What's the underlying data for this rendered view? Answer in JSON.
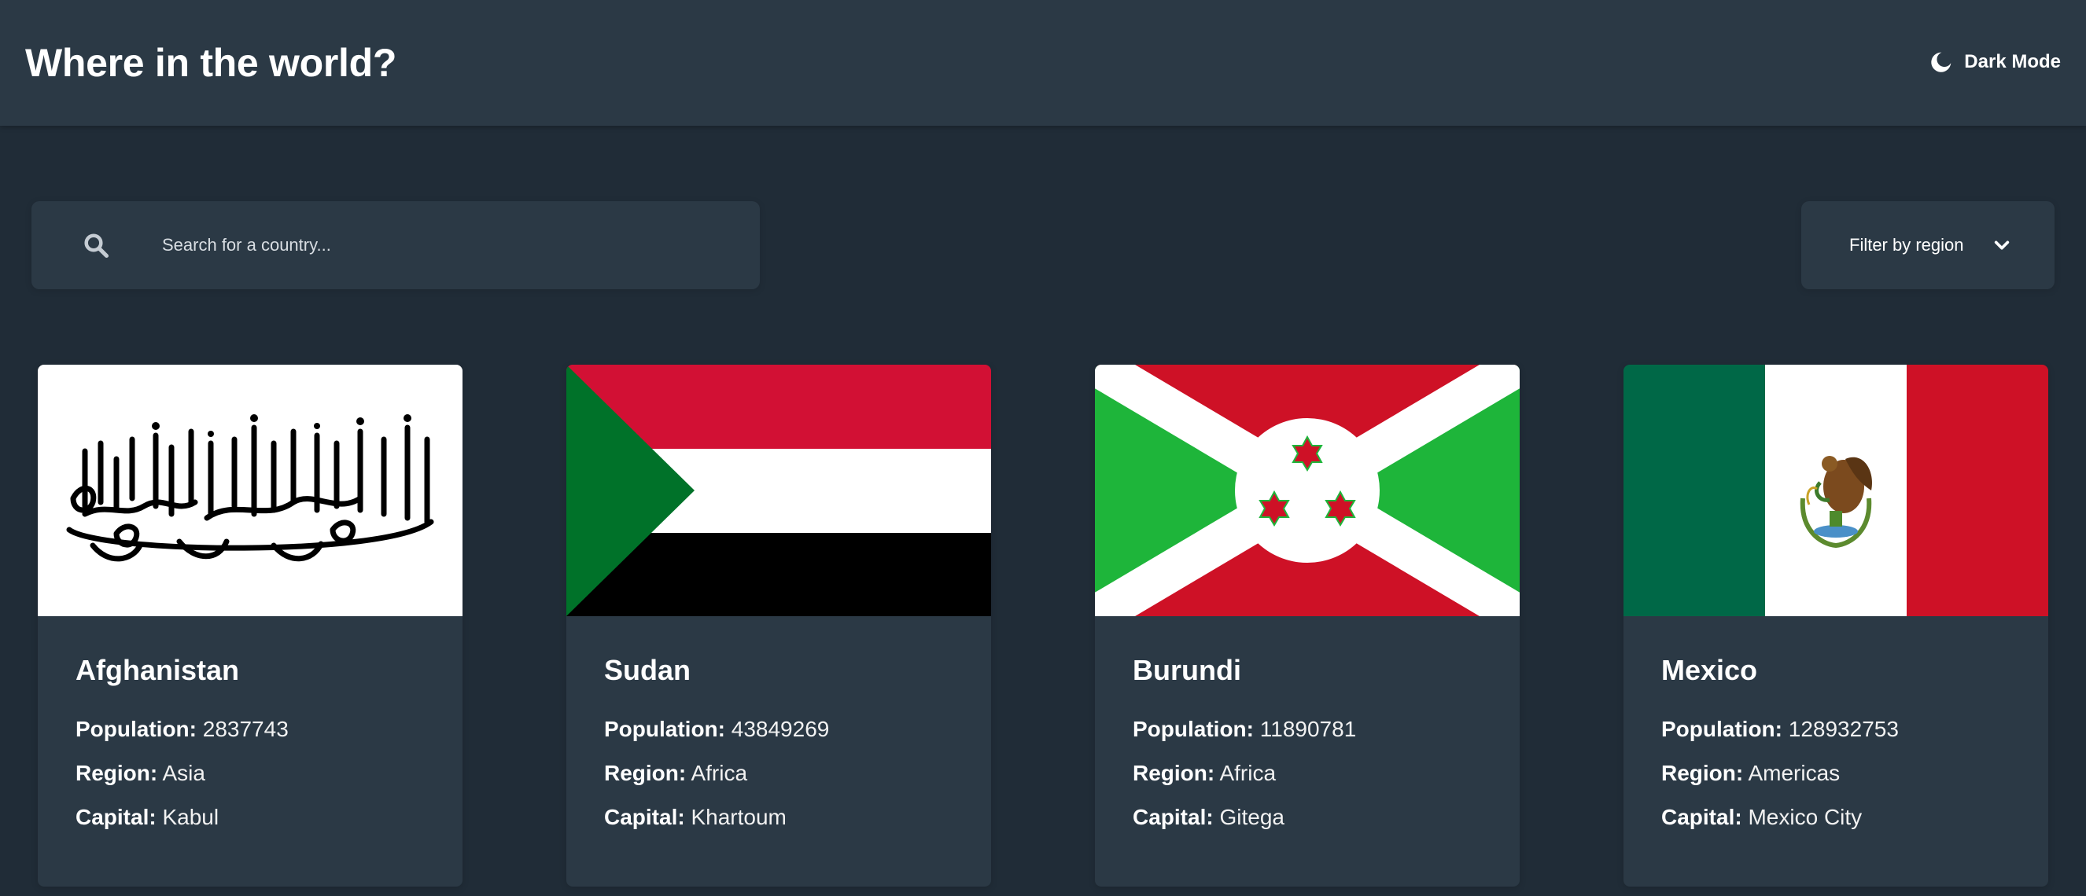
{
  "header": {
    "title": "Where in the world?",
    "theme_toggle_label": "Dark Mode"
  },
  "search": {
    "placeholder": "Search for a country..."
  },
  "filter": {
    "label": "Filter by region"
  },
  "labels": {
    "population": "Population:",
    "region": "Region:",
    "capital": "Capital:"
  },
  "icons": {
    "theme": "moon-icon",
    "search": "search-icon",
    "filter": "chevron-down-icon"
  },
  "colors": {
    "background": "#202c37",
    "elements": "#2b3945",
    "text": "#ffffff"
  },
  "countries": [
    {
      "name": "Afghanistan",
      "population": "2837743",
      "region": "Asia",
      "capital": "Kabul",
      "flag": "afghanistan-flag"
    },
    {
      "name": "Sudan",
      "population": "43849269",
      "region": "Africa",
      "capital": "Khartoum",
      "flag": "sudan-flag"
    },
    {
      "name": "Burundi",
      "population": "11890781",
      "region": "Africa",
      "capital": "Gitega",
      "flag": "burundi-flag"
    },
    {
      "name": "Mexico",
      "population": "128932753",
      "region": "Americas",
      "capital": "Mexico City",
      "flag": "mexico-flag"
    }
  ]
}
